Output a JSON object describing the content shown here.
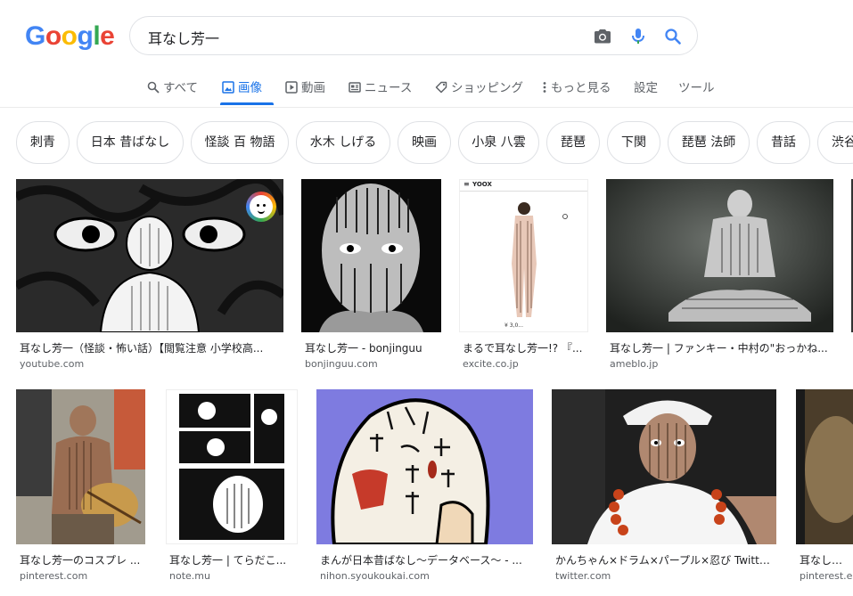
{
  "logo": {
    "letters": [
      "G",
      "o",
      "o",
      "g",
      "l",
      "e"
    ],
    "colors": [
      "#4285F4",
      "#EA4335",
      "#FBBC05",
      "#4285F4",
      "#34A853",
      "#EA4335"
    ]
  },
  "search": {
    "query": "耳なし芳一"
  },
  "tabs": [
    {
      "label": "すべて",
      "icon": "search-icon"
    },
    {
      "label": "画像",
      "icon": "image-icon",
      "active": true
    },
    {
      "label": "動画",
      "icon": "video-icon"
    },
    {
      "label": "ニュース",
      "icon": "news-icon"
    },
    {
      "label": "ショッピング",
      "icon": "tag-icon"
    },
    {
      "label": "もっと見る",
      "icon": "more-vert-icon"
    },
    {
      "label": "設定"
    },
    {
      "label": "ツール"
    }
  ],
  "chips": [
    "刺青",
    "日本 昔ばなし",
    "怪談 百 物語",
    "水木 しげる",
    "映画",
    "小泉 八雲",
    "琵琶",
    "下関",
    "琵琶 法師",
    "昔話",
    "渋谷"
  ],
  "results": [
    {
      "title": "耳なし芳一（怪談・怖い話）【閲覧注意 小学校高...",
      "source": "youtube.com"
    },
    {
      "title": "耳なし芳一 - bonjinguu",
      "source": "bonjinguu.com"
    },
    {
      "title": "まるで耳なし芳一!? 『...",
      "source": "excite.co.jp"
    },
    {
      "title": "耳なし芳一 | ファンキー・中村の\"おっかね...",
      "source": "ameblo.jp"
    },
    {
      "title": "耳なし芳一のコスプレ ...",
      "source": "pinterest.com"
    },
    {
      "title": "耳なし芳一 | てらだこ...",
      "source": "note.mu"
    },
    {
      "title": "まんが日本昔ばなし～データベース～ - ...",
      "source": "nihon.syoukoukai.com"
    },
    {
      "title": "かんちゃん×ドラム×パープル×忍び Twitte...",
      "source": "twitter.com"
    },
    {
      "title": "耳なし芳一...",
      "source": "pinterest.es"
    }
  ],
  "product_thumb": {
    "brand": "YOOX",
    "price": "¥ 3,0..."
  },
  "colors": {
    "accent": "#1a73e8"
  }
}
